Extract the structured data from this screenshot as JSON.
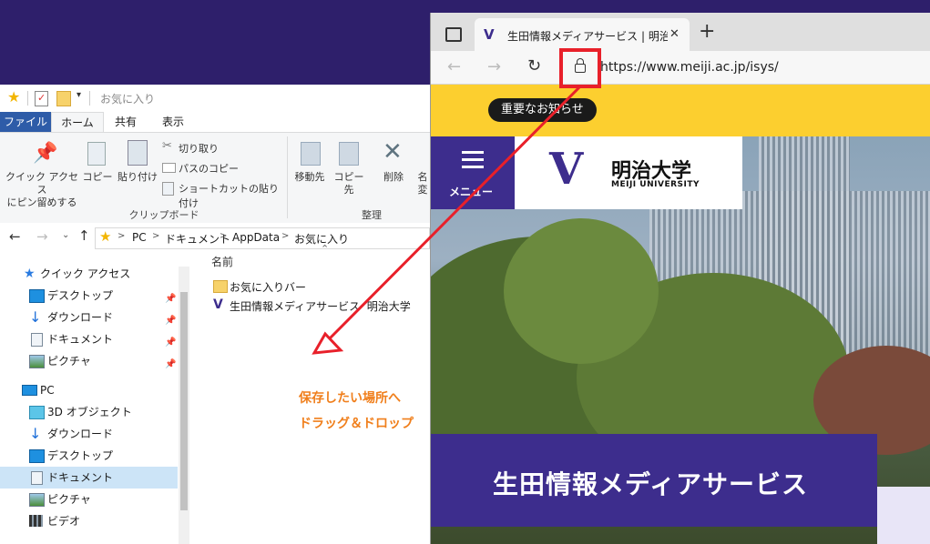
{
  "explorer": {
    "title": "お気に入り",
    "tabs": [
      "ファイル",
      "ホーム",
      "共有",
      "表示"
    ],
    "ribbon": {
      "pin_label_1": "クイック アクセス",
      "pin_label_2": "にピン留めする",
      "copy": "コピー",
      "paste": "貼り付け",
      "cut": "切り取り",
      "copy_path": "パスのコピー",
      "paste_shortcut": "ショートカットの貼り付け",
      "group_clipboard": "クリップボード",
      "move_to": "移動先",
      "copy_to": "コピー先",
      "delete": "削除",
      "rename_1": "名",
      "rename_2": "変",
      "group_organize": "整理"
    },
    "breadcrumb": [
      "PC",
      "ドキュメント",
      "AppData",
      "お気に入り"
    ],
    "nav": {
      "quick_access": "クイック アクセス",
      "quick_items": [
        "デスクトップ",
        "ダウンロード",
        "ドキュメント",
        "ピクチャ"
      ],
      "pc": "PC",
      "pc_items": [
        "3D オブジェクト",
        "ダウンロード",
        "デスクトップ",
        "ドキュメント",
        "ピクチャ",
        "ビデオ"
      ]
    },
    "column_name": "名前",
    "files": [
      "お気に入りバー",
      "生田情報メディアサービス  明治大学"
    ]
  },
  "annotation": {
    "line1": "保存したい場所へ",
    "line2": "ドラッグ＆ドロップ"
  },
  "browser": {
    "tab_title": "生田情報メディアサービス | 明治大学",
    "new_tab": "+",
    "url": "https://www.meiji.ac.jp/isys/",
    "notice": "重要なお知らせ",
    "menu_label": "メニュー",
    "logo_jp": "明治大学",
    "logo_en": "MEIJI UNIVERSITY",
    "banner_title": "生田情報メディアサービス"
  },
  "colors": {
    "purple": "#3d2d8d",
    "yellow": "#fccf2f",
    "annotation_red": "#e8202a",
    "annotation_orange": "#f07f1c"
  }
}
